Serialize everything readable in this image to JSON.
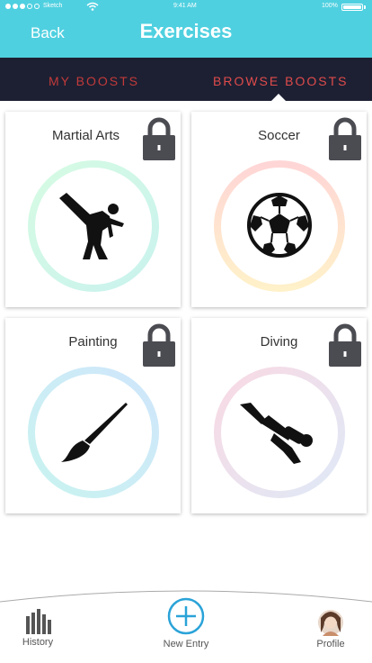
{
  "status_bar": {
    "carrier": "Sketch",
    "time": "9:41 AM",
    "battery": "100%"
  },
  "header": {
    "back_label": "Back",
    "title": "Exercises"
  },
  "tabs": [
    {
      "label": "MY BOOSTS",
      "selected": false
    },
    {
      "label": "BROWSE BOOSTS",
      "selected": true
    }
  ],
  "cards": [
    {
      "title": "Martial Arts",
      "icon": "martial-arts-icon",
      "locked": true,
      "ring_colors": [
        "#d6fbe3",
        "#c9f2ee"
      ]
    },
    {
      "title": "Soccer",
      "icon": "soccer-ball-icon",
      "locked": true,
      "ring_colors": [
        "#ffd6d6",
        "#fff1c9"
      ]
    },
    {
      "title": "Painting",
      "icon": "paintbrush-icon",
      "locked": true,
      "ring_colors": [
        "#cfe6fb",
        "#c9f3f0"
      ]
    },
    {
      "title": "Diving",
      "icon": "diver-icon",
      "locked": true,
      "ring_colors": [
        "#f9d9e3",
        "#dfe9f7"
      ]
    }
  ],
  "bottom_nav": {
    "history_label": "History",
    "new_entry_label": "New Entry",
    "profile_label": "Profile"
  },
  "colors": {
    "header": "#4fd0e0",
    "tabs_bg": "#1d2033",
    "tab_text": "#e04b4b",
    "accent": "#2aa3d8"
  }
}
